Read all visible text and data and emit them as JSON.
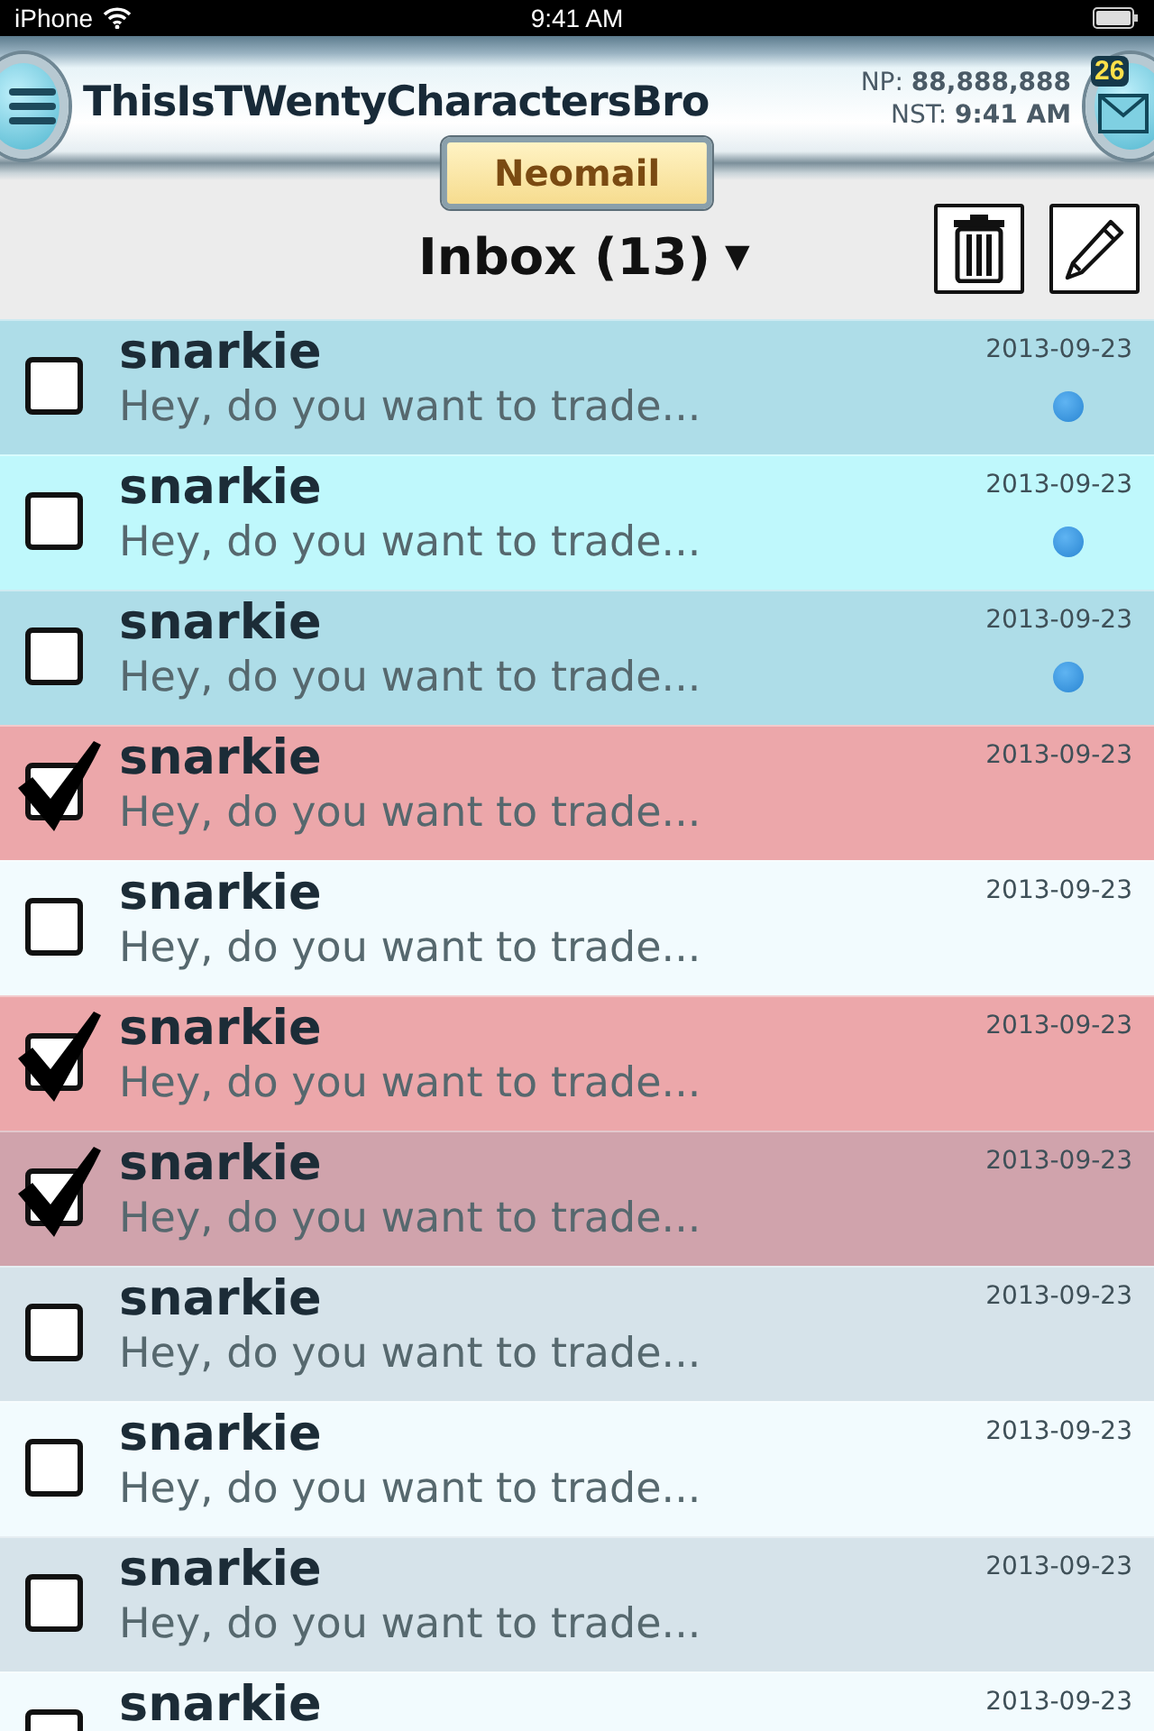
{
  "status_bar": {
    "carrier": "iPhone",
    "time": "9:41 AM"
  },
  "header": {
    "username": "ThisIsTWentyCharactersBro",
    "np_label": "NP:",
    "np_value": "88,888,888",
    "nst_label": "NST:",
    "nst_value": "9:41 AM",
    "mail_count": "26",
    "section": "Neomail"
  },
  "toolbar": {
    "folder": "Inbox (13)",
    "caret": "▼"
  },
  "messages": [
    {
      "sender": "snarkie",
      "preview": "Hey, do you want to trade...",
      "date": "2013-09-23",
      "unread": true,
      "checked": false
    },
    {
      "sender": "snarkie",
      "preview": "Hey, do you want to trade...",
      "date": "2013-09-23",
      "unread": true,
      "checked": false
    },
    {
      "sender": "snarkie",
      "preview": "Hey, do you want to trade...",
      "date": "2013-09-23",
      "unread": true,
      "checked": false
    },
    {
      "sender": "snarkie",
      "preview": "Hey, do you want to trade...",
      "date": "2013-09-23",
      "unread": false,
      "checked": true
    },
    {
      "sender": "snarkie",
      "preview": "Hey, do you want to trade...",
      "date": "2013-09-23",
      "unread": false,
      "checked": false
    },
    {
      "sender": "snarkie",
      "preview": "Hey, do you want to trade...",
      "date": "2013-09-23",
      "unread": false,
      "checked": true
    },
    {
      "sender": "snarkie",
      "preview": "Hey, do you want to trade...",
      "date": "2013-09-23",
      "unread": false,
      "checked": true
    },
    {
      "sender": "snarkie",
      "preview": "Hey, do you want to trade...",
      "date": "2013-09-23",
      "unread": false,
      "checked": false
    },
    {
      "sender": "snarkie",
      "preview": "Hey, do you want to trade...",
      "date": "2013-09-23",
      "unread": false,
      "checked": false
    },
    {
      "sender": "snarkie",
      "preview": "Hey, do you want to trade...",
      "date": "2013-09-23",
      "unread": false,
      "checked": false
    },
    {
      "sender": "snarkie",
      "date": "2013-09-23",
      "unread": false,
      "checked": false
    }
  ]
}
